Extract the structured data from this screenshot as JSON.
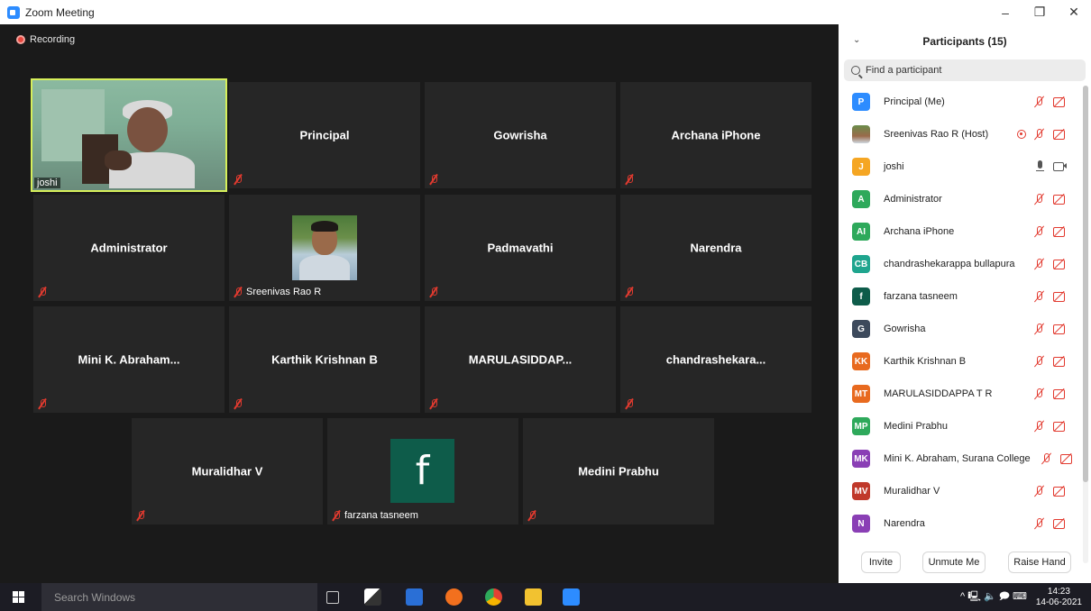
{
  "window": {
    "title": "Zoom Meeting",
    "controls": [
      "–",
      "❐",
      "✕"
    ]
  },
  "recording": {
    "label": "Recording"
  },
  "gallery": {
    "active_speaker": {
      "label": "joshi"
    },
    "tiles": [
      {
        "name": "Principal",
        "muted": true
      },
      {
        "name": "Gowrisha",
        "muted": true
      },
      {
        "name": "Archana iPhone",
        "muted": true
      },
      {
        "name": "Administrator",
        "muted": true
      },
      {
        "name": "Sreenivas Rao R",
        "muted": true,
        "photo": true
      },
      {
        "name": "Padmavathi",
        "muted": true
      },
      {
        "name": "Narendra",
        "muted": true
      },
      {
        "name": "Mini K. Abraham...",
        "muted": true
      },
      {
        "name": "Karthik Krishnan B",
        "muted": true
      },
      {
        "name": "MARULASIDDAP...",
        "muted": true
      },
      {
        "name": "chandrashekara...",
        "muted": true
      },
      {
        "name": "Muralidhar V",
        "muted": true
      },
      {
        "name": "farzana tasneem",
        "muted": true,
        "avatar_letter": "f"
      },
      {
        "name": "Medini Prabhu",
        "muted": true
      }
    ]
  },
  "panel": {
    "title": "Participants (15)",
    "search_placeholder": "Find a participant",
    "participants": [
      {
        "initials": "P",
        "color": "#2d8cff",
        "name": "Principal (Me)"
      },
      {
        "initials": "",
        "color": "",
        "name": "Sreenivas Rao R (Host)",
        "photo": true,
        "recording": true
      },
      {
        "initials": "J",
        "color": "#f5a623",
        "name": "joshi",
        "mic_on": true
      },
      {
        "initials": "A",
        "color": "#2ea95b",
        "name": "Administrator"
      },
      {
        "initials": "AI",
        "color": "#2ea95b",
        "name": "Archana iPhone"
      },
      {
        "initials": "CB",
        "color": "#1fa58e",
        "name": "chandrashekarappa bullapura"
      },
      {
        "initials": "f",
        "color": "#0e5c4a",
        "name": "farzana tasneem"
      },
      {
        "initials": "G",
        "color": "#3d4a5c",
        "name": "Gowrisha"
      },
      {
        "initials": "KK",
        "color": "#e86a1f",
        "name": "Karthik Krishnan B"
      },
      {
        "initials": "MT",
        "color": "#e86a1f",
        "name": "MARULASIDDAPPA T R"
      },
      {
        "initials": "MP",
        "color": "#2ea95b",
        "name": "Medini Prabhu"
      },
      {
        "initials": "MK",
        "color": "#8a3fb5",
        "name": "Mini K. Abraham, Surana College"
      },
      {
        "initials": "MV",
        "color": "#c0392b",
        "name": "Muralidhar V"
      },
      {
        "initials": "N",
        "color": "#8a3fb5",
        "name": "Narendra"
      }
    ],
    "buttons": {
      "invite": "Invite",
      "unmute": "Unmute Me",
      "raise_hand": "Raise Hand"
    }
  },
  "taskbar": {
    "search_placeholder": "Search Windows",
    "time": "14:23",
    "date": "14-06-2021",
    "tray_icons": "^ 🖳 🔈 🗩 ⌨"
  }
}
